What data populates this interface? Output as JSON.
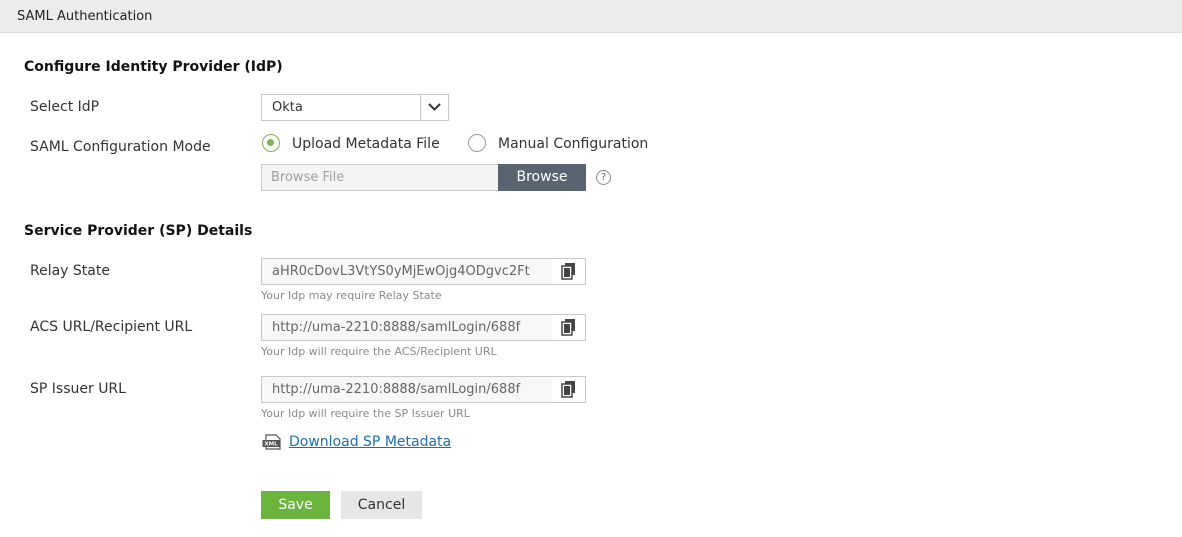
{
  "header": {
    "title": "SAML Authentication"
  },
  "idp_section": {
    "title": "Configure Identity Provider (IdP)",
    "select_idp_label": "Select IdP",
    "select_idp_value": "Okta",
    "mode_label": "SAML Configuration Mode",
    "mode_options": [
      {
        "label": "Upload Metadata File",
        "checked": true
      },
      {
        "label": "Manual Configuration",
        "checked": false
      }
    ],
    "file_placeholder": "Browse File",
    "browse_label": "Browse",
    "help_glyph": "?"
  },
  "sp_section": {
    "title": "Service Provider (SP) Details",
    "fields": [
      {
        "label": "Relay State",
        "value": "aHR0cDovL3VtYS0yMjEwOjg4ODgvc2Ft",
        "hint": "Your Idp may require Relay State"
      },
      {
        "label": "ACS URL/Recipient URL",
        "value": "http://uma-2210:8888/samlLogin/688f",
        "hint": "Your Idp will require the ACS/Recipient URL"
      },
      {
        "label": "SP Issuer URL",
        "value": "http://uma-2210:8888/samlLogin/688f",
        "hint": "Your Idp will require the SP Issuer URL"
      }
    ],
    "download_label": "Download SP Metadata",
    "xml_icon_text": "XML"
  },
  "actions": {
    "save_label": "Save",
    "cancel_label": "Cancel"
  },
  "colors": {
    "accent_green": "#6bb43e",
    "link_blue": "#1b6fb5",
    "browse_dark": "#5a6470"
  }
}
